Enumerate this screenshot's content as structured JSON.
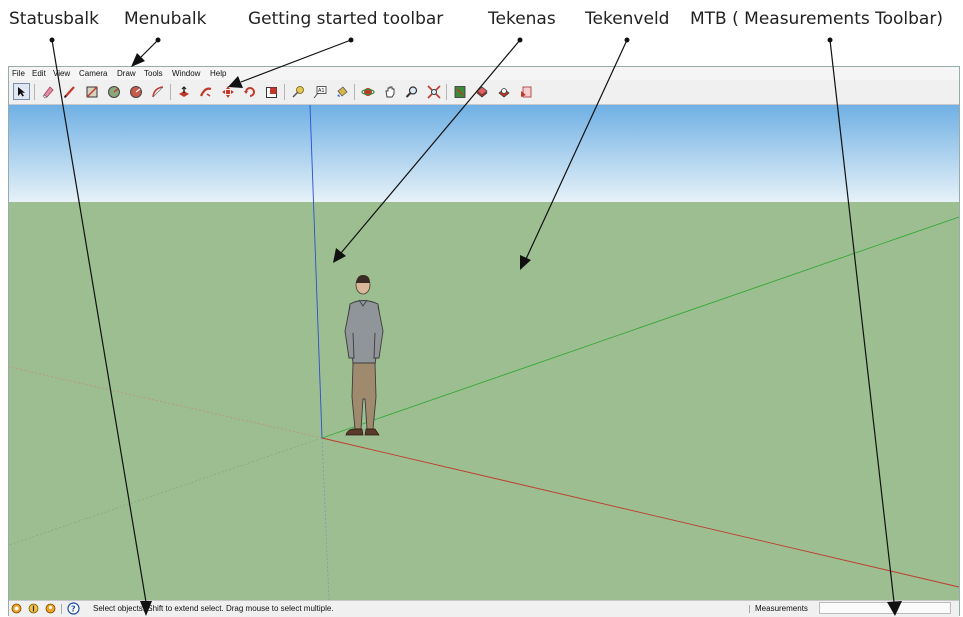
{
  "annotations": {
    "statusbalk": "Statusbalk",
    "menubalk": "Menubalk",
    "getting_started": "Getting started toolbar",
    "tekenas": "Tekenas",
    "tekenveld": "Tekenveld",
    "mtb": "MTB ( Measurements Toolbar)"
  },
  "menu": {
    "file": "File",
    "edit": "Edit",
    "view": "View",
    "camera": "Camera",
    "draw": "Draw",
    "tools": "Tools",
    "window": "Window",
    "help": "Help"
  },
  "toolbar_icons": [
    "select-icon",
    "eraser-icon",
    "line-icon",
    "rectangle-icon",
    "circle-icon",
    "polygon-icon",
    "arc-icon",
    "push-pull-icon",
    "follow-me-icon",
    "move-icon",
    "rotate-icon",
    "scale-icon",
    "tape-measure-icon",
    "text-icon",
    "paint-bucket-icon",
    "orbit-icon",
    "pan-icon",
    "zoom-icon",
    "zoom-extents-icon",
    "model-info-icon",
    "warehouse-icon",
    "extension-warehouse-icon",
    "layout-icon"
  ],
  "status": {
    "text": "Select objects. Shift to extend select. Drag mouse to select multiple.",
    "measurements_label": "Measurements",
    "measurements_value": ""
  },
  "colors": {
    "sky_top": "#6fb0e4",
    "sky_bottom": "#e8f2f8",
    "ground": "#9cbe91",
    "axis_red": "#c0392b",
    "axis_green": "#3aa83a",
    "axis_blue": "#2a4fd0"
  }
}
